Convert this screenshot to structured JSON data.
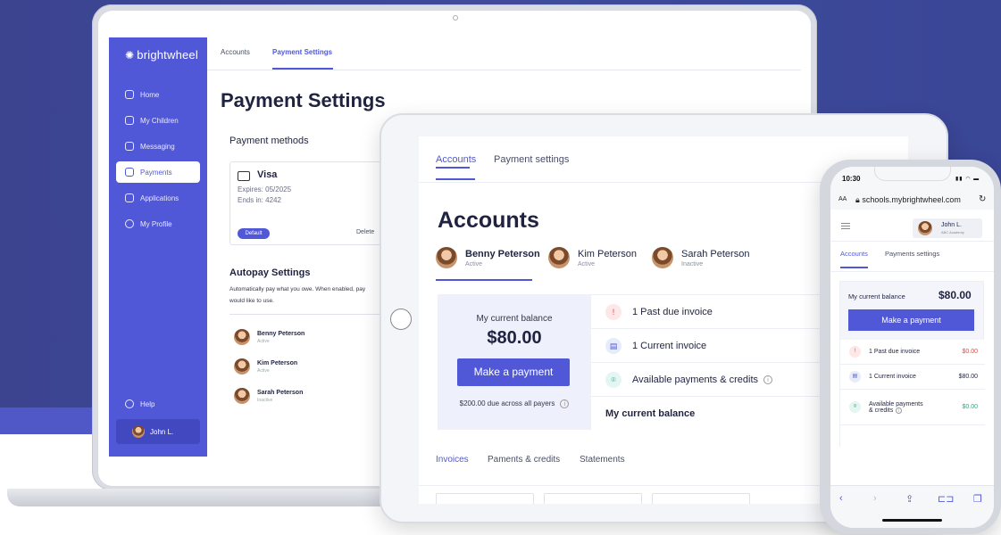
{
  "laptop": {
    "logo": "brightwheel",
    "sidebar": {
      "items": [
        {
          "label": "Home",
          "icon": "home-icon",
          "active": false
        },
        {
          "label": "My Children",
          "icon": "children-icon",
          "active": false
        },
        {
          "label": "Messaging",
          "icon": "messaging-icon",
          "active": false
        },
        {
          "label": "Payments",
          "icon": "payments-icon",
          "active": true
        },
        {
          "label": "Applications",
          "icon": "applications-icon",
          "active": false
        },
        {
          "label": "My Profile",
          "icon": "profile-icon",
          "active": false
        }
      ],
      "help": "Help",
      "user": "John L."
    },
    "tabs": [
      {
        "label": "Accounts",
        "active": false
      },
      {
        "label": "Payment Settings",
        "active": true
      }
    ],
    "title": "Payment Settings",
    "payment_methods": {
      "heading": "Payment methods",
      "card": {
        "brand": "Visa",
        "expires": "Expires: 05/2025",
        "ends": "Ends in: 4242",
        "badge": "Default",
        "delete": "Delete"
      }
    },
    "autopay": {
      "heading": "Autopay Settings",
      "description": "Automatically pay what you owe. When enabled, pay",
      "description2": "would like to use.",
      "children": [
        {
          "name": "Benny Peterson",
          "status": "Active"
        },
        {
          "name": "Kim Peterson",
          "status": "Active"
        },
        {
          "name": "Sarah Peterson",
          "status": "Inactive"
        }
      ]
    }
  },
  "tablet": {
    "tabs": [
      {
        "label": "Accounts",
        "active": true
      },
      {
        "label": "Payment settings",
        "active": false
      }
    ],
    "title": "Accounts",
    "people": [
      {
        "name": "Benny Peterson",
        "status": "Active"
      },
      {
        "name": "Kim Peterson",
        "status": "Active"
      },
      {
        "name": "Sarah Peterson",
        "status": "Inactive"
      }
    ],
    "balance": {
      "label": "My current balance",
      "amount": "$80.00",
      "pay_button": "Make a payment",
      "due_text": "$200.00 due across all payers"
    },
    "rows": [
      {
        "label": "1 Past due invoice",
        "icon": "alert-icon"
      },
      {
        "label": "1 Current invoice",
        "icon": "invoice-icon"
      },
      {
        "label": "Available payments & credits",
        "icon": "credits-icon"
      },
      {
        "label": "My current balance"
      }
    ],
    "subtabs": [
      {
        "label": "Invoices",
        "active": true
      },
      {
        "label": "Paments & credits",
        "active": false
      },
      {
        "label": "Statements",
        "active": false
      }
    ]
  },
  "phone": {
    "time": "10:30",
    "url_aa": "AA",
    "url": "schools.mybrightwheel.com",
    "user": {
      "name": "John L.",
      "school": "ABC Academy"
    },
    "tabs": [
      {
        "label": "Accounts",
        "active": true
      },
      {
        "label": "Payments settings",
        "active": false
      }
    ],
    "balance": {
      "label": "My current balance",
      "amount": "$80.00",
      "pay_button": "Make a payment"
    },
    "rows": [
      {
        "label": "1 Past due invoice",
        "amount": "$0.00",
        "tone": "red"
      },
      {
        "label": "1 Current invoice",
        "amount": "$80.00",
        "tone": "plain"
      },
      {
        "label": "Available payments",
        "label2": "& credits",
        "amount": "$0.00",
        "tone": "green"
      }
    ]
  },
  "colors": {
    "brand": "#5158d8",
    "background_band": "#3f4a9c",
    "danger": "#e04848",
    "success": "#2aa889"
  }
}
